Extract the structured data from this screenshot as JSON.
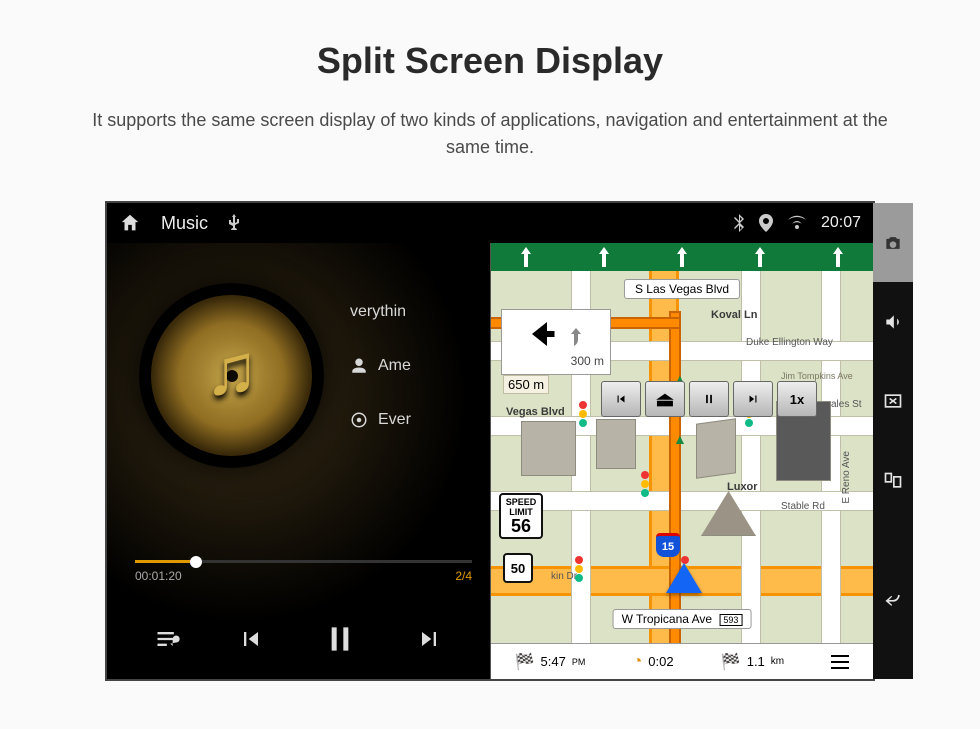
{
  "page": {
    "title": "Split Screen Display",
    "subtitle": "It supports the same screen display of two kinds of applications, navigation and entertainment at the same time."
  },
  "status_bar": {
    "app_label": "Music",
    "time": "20:07"
  },
  "music": {
    "now_playing_partial": "verythin",
    "artist_partial": "Ame",
    "next_partial": "Ever",
    "elapsed": "00:01:20",
    "track_index": "2/4"
  },
  "nav": {
    "top_street": "S Las Vegas Blvd",
    "turn_distance_small": "300 m",
    "turn_distance_main": "650 m",
    "speed_limit_label": "SPEED LIMIT",
    "speed_limit_value": "56",
    "route_number": "50",
    "interstate_number": "15",
    "bottom_street": "W Tropicana Ave",
    "bottom_street_badge": "593",
    "sim_speed": "1x",
    "labels": {
      "koval": "Koval Ln",
      "duke": "Duke Ellington Way",
      "vegas_blvd": "Vegas Blvd",
      "luxor": "Luxor",
      "stable": "Stable Rd",
      "reno": "E Reno Ave",
      "tompkins": "Jim Tompkins Ave",
      "ales": "ales St",
      "kin": "kin Dr"
    },
    "footer": {
      "eta": "5:47",
      "dur": "0:02",
      "dist": "1.1",
      "dist_unit": "km"
    }
  },
  "icons": {
    "home": "home-icon",
    "usb": "usb-icon",
    "bluetooth": "bluetooth-icon",
    "location": "location-icon",
    "wifi": "wifi-icon",
    "camera": "camera-icon",
    "volume": "volume-icon",
    "close_screen": "close-screen-icon",
    "recent": "recent-apps-icon",
    "back": "back-icon"
  }
}
